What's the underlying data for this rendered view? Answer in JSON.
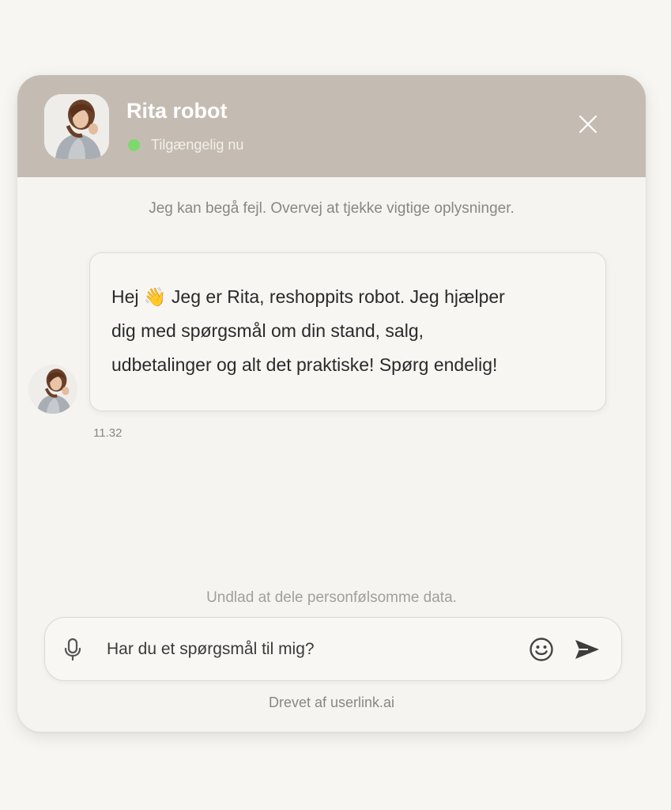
{
  "header": {
    "title": "Rita robot",
    "status": "Tilgængelig nu",
    "status_color": "#7dd96b",
    "background": "#c4bcb2",
    "avatar_icon": "avatar"
  },
  "disclaimer": "Jeg kan begå fejl. Overvej at tjekke vigtige oplysninger.",
  "messages": [
    {
      "sender": "bot",
      "lines": [
        "Hej 👋 Jeg er Rita, reshoppits robot. Jeg hjælper",
        "dig med spørgsmål om din stand, salg,",
        "udbetalinger og alt det praktiske! Spørg endelig!"
      ],
      "time": "11.32"
    }
  ],
  "privacy_note": "Undlad at dele personfølsomme data.",
  "input": {
    "value": "",
    "placeholder": "Har du et spørgsmål til mig?"
  },
  "icons": {
    "close": "close-icon",
    "mic": "microphone-icon",
    "emoji": "smiley-icon",
    "send": "send-icon"
  },
  "footer": {
    "powered_by": "Drevet af userlink.ai"
  }
}
